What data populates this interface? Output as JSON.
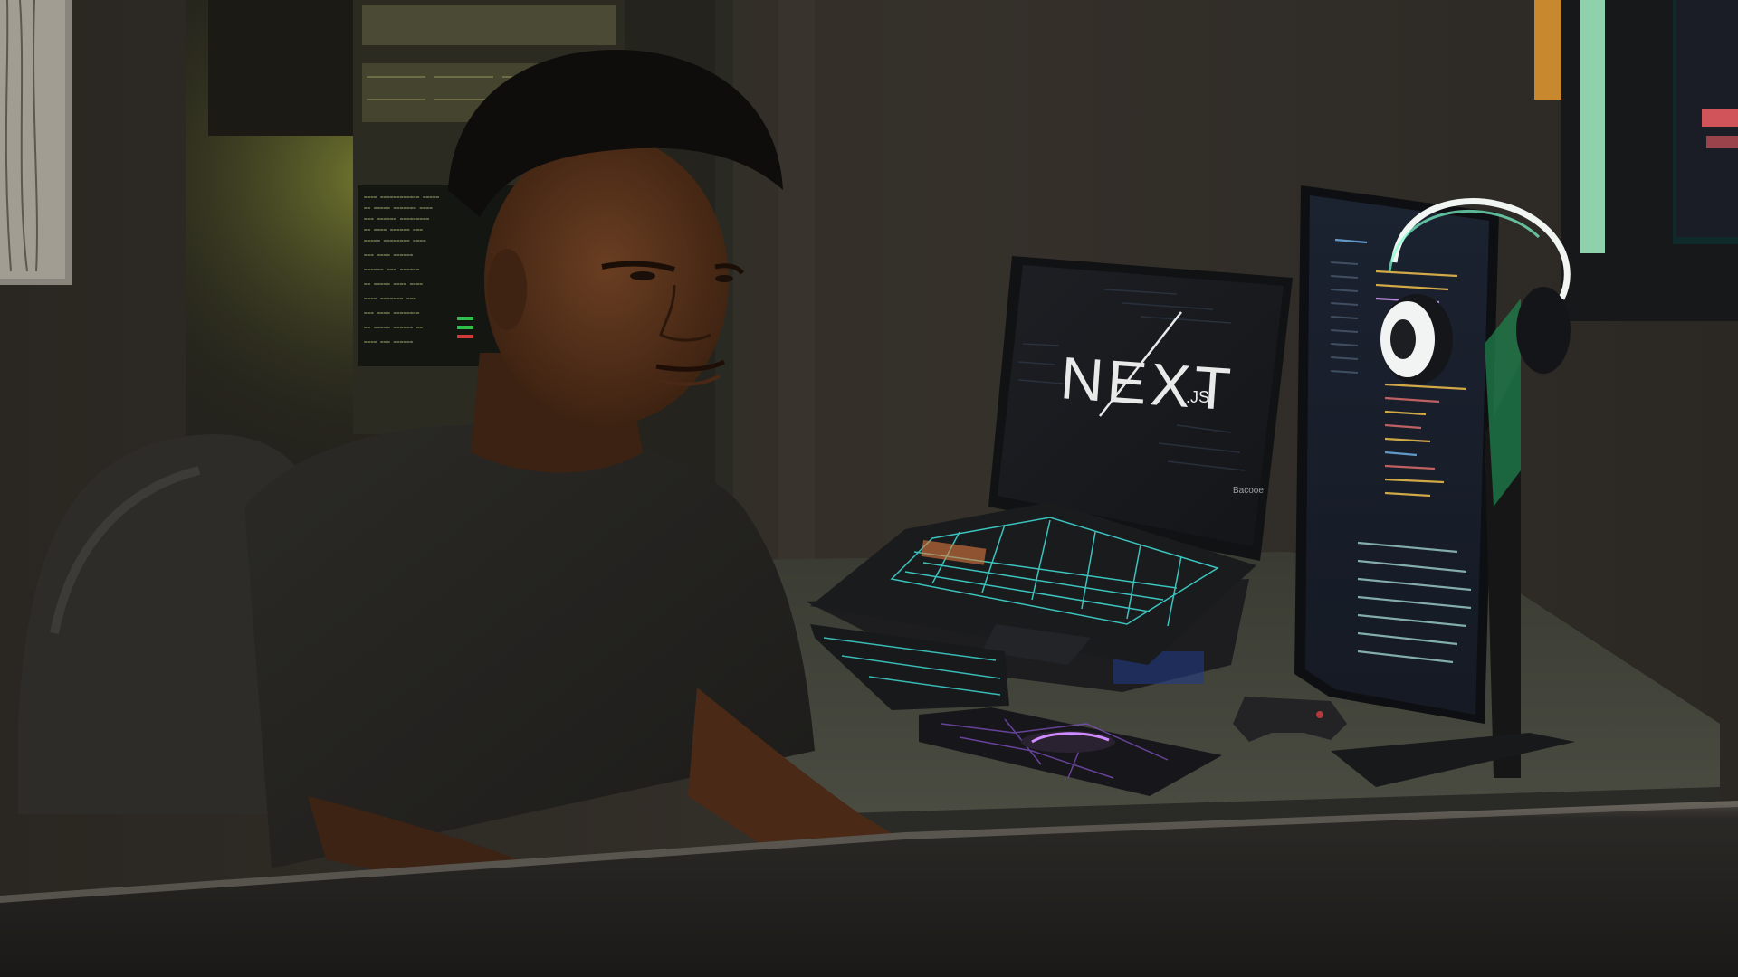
{
  "scene": {
    "laptop_screen": {
      "logo_main": "NEXT",
      "logo_suffix": ".JS",
      "brand": "Bacooe"
    }
  },
  "colors": {
    "wall": "#2f2b25",
    "rack_glow": "#c9d34a",
    "laptop_keys": "#3fd6d0",
    "mousepad_accent": "#b25cff",
    "headphone_glow": "#7dffd0",
    "monitor_code_accent": "#e6b84a"
  }
}
